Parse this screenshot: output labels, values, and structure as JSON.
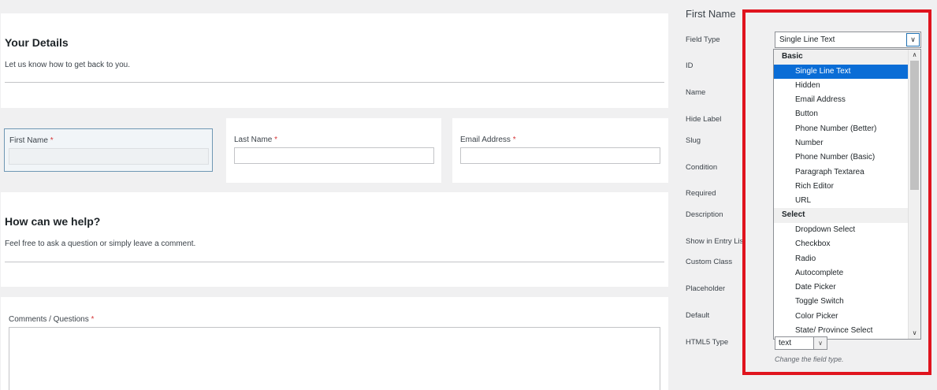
{
  "form": {
    "section1": {
      "title": "Your Details",
      "desc": "Let us know how to get back to you."
    },
    "fields": [
      {
        "label": "First Name",
        "req": "*"
      },
      {
        "label": "Last Name",
        "req": "*"
      },
      {
        "label": "Email Address",
        "req": "*"
      }
    ],
    "section2": {
      "title": "How can we help?",
      "desc": "Feel free to ask a question or simply leave a comment."
    },
    "comments": {
      "label": "Comments / Questions",
      "req": "*"
    }
  },
  "settings": {
    "title": "First Name",
    "labels": {
      "field_type": "Field Type",
      "id": "ID",
      "name": "Name",
      "hide_label": "Hide Label",
      "slug": "Slug",
      "condition": "Condition",
      "required": "Required",
      "description": "Description",
      "show_in_entry_list": "Show in Entry List",
      "custom_class": "Custom Class",
      "placeholder": "Placeholder",
      "default": "Default",
      "html5_type": "HTML5 Type"
    },
    "field_type_value": "Single Line Text",
    "html5_type_value": "text",
    "hint": "Change the field type.",
    "dropdown": {
      "groups": [
        {
          "label": "Basic",
          "items": [
            "Single Line Text",
            "Hidden",
            "Email Address",
            "Button",
            "Phone Number (Better)",
            "Number",
            "Phone Number (Basic)",
            "Paragraph Textarea",
            "Rich Editor",
            "URL"
          ]
        },
        {
          "label": "Select",
          "items": [
            "Dropdown Select",
            "Checkbox",
            "Radio",
            "Autocomplete",
            "Date Picker",
            "Toggle Switch",
            "Color Picker",
            "State/ Province Select"
          ]
        }
      ],
      "selected": "Single Line Text"
    }
  },
  "colors": {
    "highlight": "#e0141e",
    "selection": "#0a6dd6",
    "required": "#d63638"
  }
}
